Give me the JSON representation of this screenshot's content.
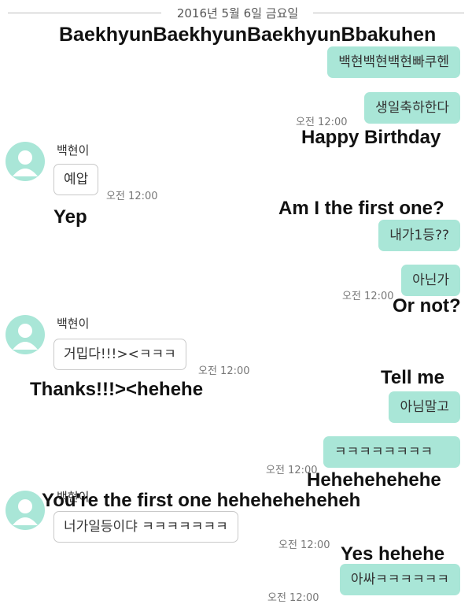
{
  "date_separator": "2016년 5월 6일 금요일",
  "colors": {
    "my_bubble": "#a9e6d7",
    "their_bubble": "#ffffff",
    "avatar": "#a9e6d7"
  },
  "messages": [
    {
      "from": "me",
      "text": "백현백현백현빠쿠헨",
      "caption": "BaekhyunBaekhyunBaekhyunBbakuhen"
    },
    {
      "from": "me",
      "text": "생일축하한다",
      "time": "오전 12:00",
      "caption": "Happy Birthday"
    },
    {
      "from": "other",
      "sender": "백현이",
      "text": "예압",
      "time": "오전 12:00",
      "caption": "Yep"
    },
    {
      "from": "me",
      "text": "내가1등??",
      "caption": "Am I the first one?"
    },
    {
      "from": "me",
      "text": "아닌가",
      "time": "오전 12:00",
      "caption": "Or not?"
    },
    {
      "from": "other",
      "sender": "백현이",
      "text": "거밉다!!!><ㅋㅋㅋ",
      "time": "오전 12:00",
      "caption": "Thanks!!!><hehehe"
    },
    {
      "from": "me",
      "text": "아님말고",
      "caption": "Tell me"
    },
    {
      "from": "me",
      "text": "ㅋㅋㅋㅋㅋㅋㅋㅋ",
      "time": "오전 12:00",
      "caption": "Hehehehehehe"
    },
    {
      "from": "other",
      "sender": "백현이",
      "text": "너가일등이댜 ㅋㅋㅋㅋㅋㅋㅋ",
      "time": "오전 12:00",
      "caption": "You're the first one heheheheheheh"
    },
    {
      "from": "me",
      "text": "아싸ㅋㅋㅋㅋㅋㅋ",
      "time": "오전 12:00",
      "caption": "Yes hehehe"
    }
  ]
}
